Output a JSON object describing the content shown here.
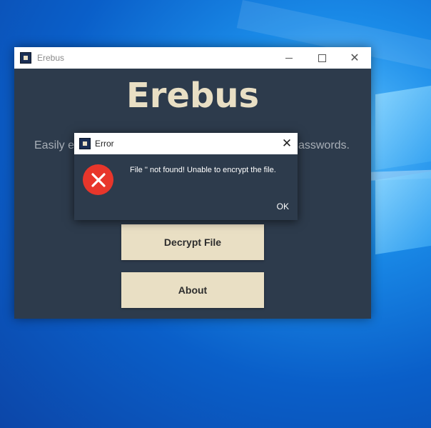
{
  "main_window": {
    "title": "Erebus",
    "app_heading": "Erebus",
    "subtitle_left": "Easily e",
    "subtitle_right": "asswords.",
    "buttons": {
      "decrypt": "Decrypt File",
      "about": "About"
    },
    "controls": {
      "minimize": "minimize",
      "maximize": "maximize",
      "close": "✕"
    }
  },
  "error_dialog": {
    "title": "Error",
    "message": "File '' not found! Unable to encrypt the file.",
    "ok_label": "OK",
    "close": "✕"
  },
  "colors": {
    "window_bg": "#2d3b4c",
    "heading": "#e9dfc4",
    "button_bg": "#e9dfc4",
    "error_red": "#e8362b"
  }
}
